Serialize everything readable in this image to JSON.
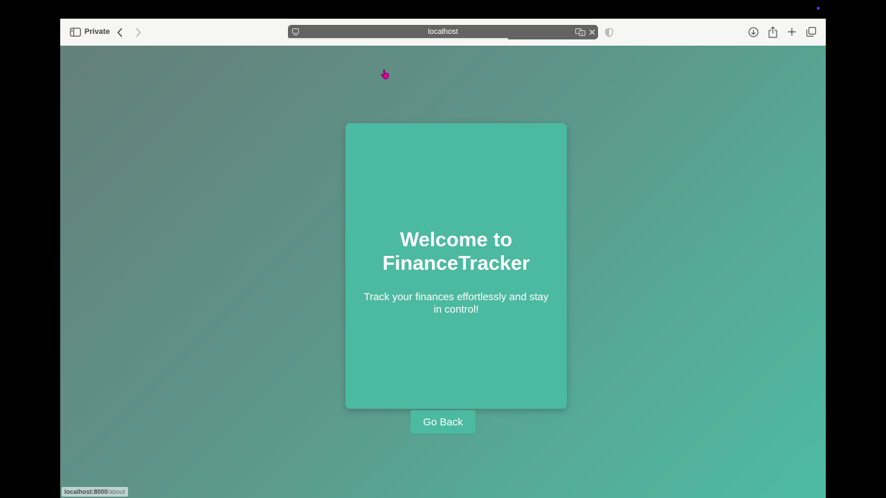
{
  "browser": {
    "private_label": "Private",
    "address": "localhost",
    "progress": 0.71,
    "icons": {
      "sidebar": "sidebar-icon",
      "back": "chevron-left-icon",
      "forward": "chevron-right-icon",
      "page": "page-icon",
      "translate": "translate-icon",
      "clear": "close-icon",
      "privacy": "shield-icon",
      "downloads": "download-icon",
      "share": "share-icon",
      "new_tab": "plus-icon",
      "tab_overview": "tabs-icon"
    }
  },
  "page": {
    "title": "Welcome to FinanceTracker",
    "subtitle": "Track your finances effortlessly and stay in control!",
    "go_back_label": "Go Back",
    "accent_color": "#4cb9a1"
  },
  "status_bar": {
    "host": "localhost:8000",
    "path": "/about"
  }
}
